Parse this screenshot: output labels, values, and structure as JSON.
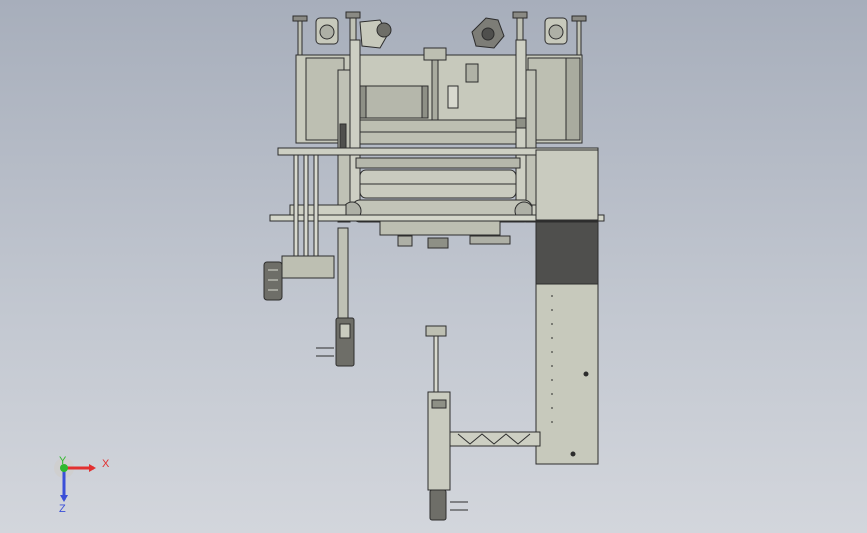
{
  "viewport": {
    "background_top": "#a7aebb",
    "background_bottom": "#d3d6dc",
    "part_fill": "#c7c9bc",
    "part_fill_dark": "#4f4f4d",
    "part_stroke": "#2d2d2d"
  },
  "triad": {
    "x_label": "X",
    "y_label": "Y",
    "z_label": "Z",
    "x_color": "#e23030",
    "y_color": "#2eb82e",
    "z_color": "#3a4fd8"
  }
}
